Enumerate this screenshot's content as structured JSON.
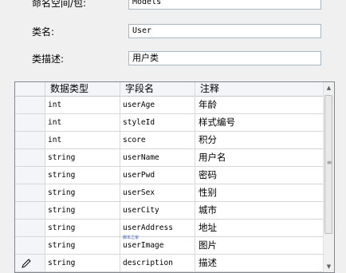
{
  "form": {
    "namespace_label": "命名空间/包:",
    "namespace_value": "Models",
    "class_label": "类名:",
    "class_value": "User",
    "desc_label": "类描述:",
    "desc_value": "用户类"
  },
  "grid": {
    "columns": [
      "数据类型",
      "字段名",
      "注释"
    ],
    "rows": [
      {
        "type": "int",
        "name": "userAge",
        "note": "年龄"
      },
      {
        "type": "int",
        "name": "styleId",
        "note": "样式编号"
      },
      {
        "type": "int",
        "name": "score",
        "note": "积分"
      },
      {
        "type": "string",
        "name": "userName",
        "note": "用户名"
      },
      {
        "type": "string",
        "name": "userPwd",
        "note": "密码"
      },
      {
        "type": "string",
        "name": "userSex",
        "note": "性别"
      },
      {
        "type": "string",
        "name": "userCity",
        "note": "城市"
      },
      {
        "type": "string",
        "name": "userAddress",
        "note": "地址"
      },
      {
        "type": "string",
        "name": "userImage",
        "note": "图片"
      },
      {
        "type": "string",
        "name": "description",
        "note": "描述"
      }
    ],
    "edit_row_icon": "pencil-icon"
  },
  "watermark": "脚本之家"
}
